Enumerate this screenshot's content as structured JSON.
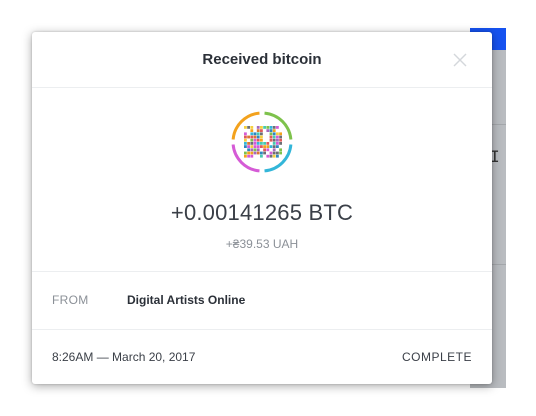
{
  "modal": {
    "title": "Received bitcoin"
  },
  "transaction": {
    "amount": "+0.00141265 BTC",
    "fiat_amount": "+₴39.53 UAH",
    "from_label": "FROM",
    "from_value": "Digital Artists Online",
    "timestamp": "8:26AM — March 20, 2017",
    "status": "COMPLETE"
  },
  "icons": {
    "close": "close-icon",
    "avatar": "sender-avatar-icon"
  },
  "colors": {
    "brand_blue": "#1652f0",
    "avatar_ring": [
      "#f3a21d",
      "#7ec24c",
      "#33b6d9",
      "#d55bd6"
    ]
  }
}
